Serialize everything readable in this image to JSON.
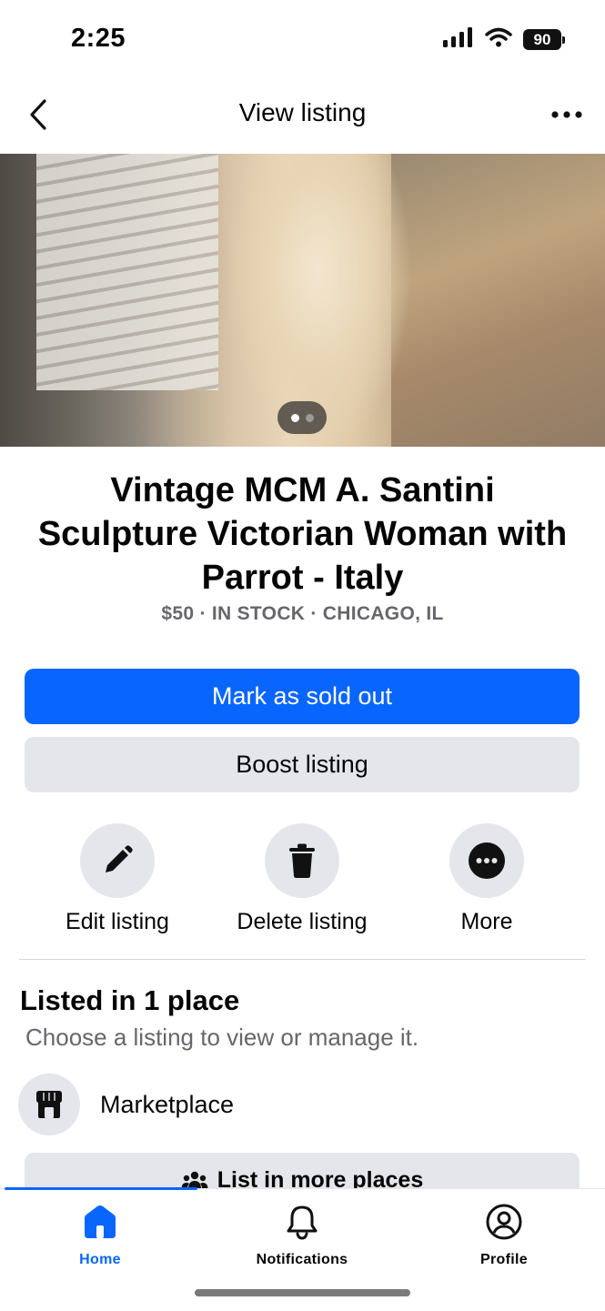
{
  "status_bar": {
    "time": "2:25",
    "battery": "90"
  },
  "header": {
    "title": "View listing"
  },
  "listing": {
    "title": "Vintage MCM A. Santini Sculpture Victorian Woman with Parrot - Italy",
    "subline": "$50 · IN STOCK · CHICAGO, IL",
    "photo_count": 2,
    "photo_index": 1
  },
  "buttons": {
    "mark_sold": "Mark as sold out",
    "boost": "Boost listing"
  },
  "actions": [
    {
      "label": "Edit listing",
      "icon": "pencil-icon"
    },
    {
      "label": "Delete listing",
      "icon": "trash-icon"
    },
    {
      "label": "More",
      "icon": "more-icon"
    }
  ],
  "places": {
    "title": "Listed in 1 place",
    "subtitle": "Choose a listing to view or manage it.",
    "items": [
      {
        "label": "Marketplace",
        "icon": "storefront-icon"
      }
    ],
    "list_more": "List in more places"
  },
  "tabbar": {
    "tabs": [
      {
        "label": "Home",
        "icon": "home-icon",
        "active": true
      },
      {
        "label": "Notifications",
        "icon": "bell-icon",
        "active": false
      },
      {
        "label": "Profile",
        "icon": "profile-icon",
        "active": false
      }
    ]
  },
  "colors": {
    "accent": "#0866ff",
    "secondary_bg": "#e4e6eb",
    "muted_text": "#65676b"
  }
}
